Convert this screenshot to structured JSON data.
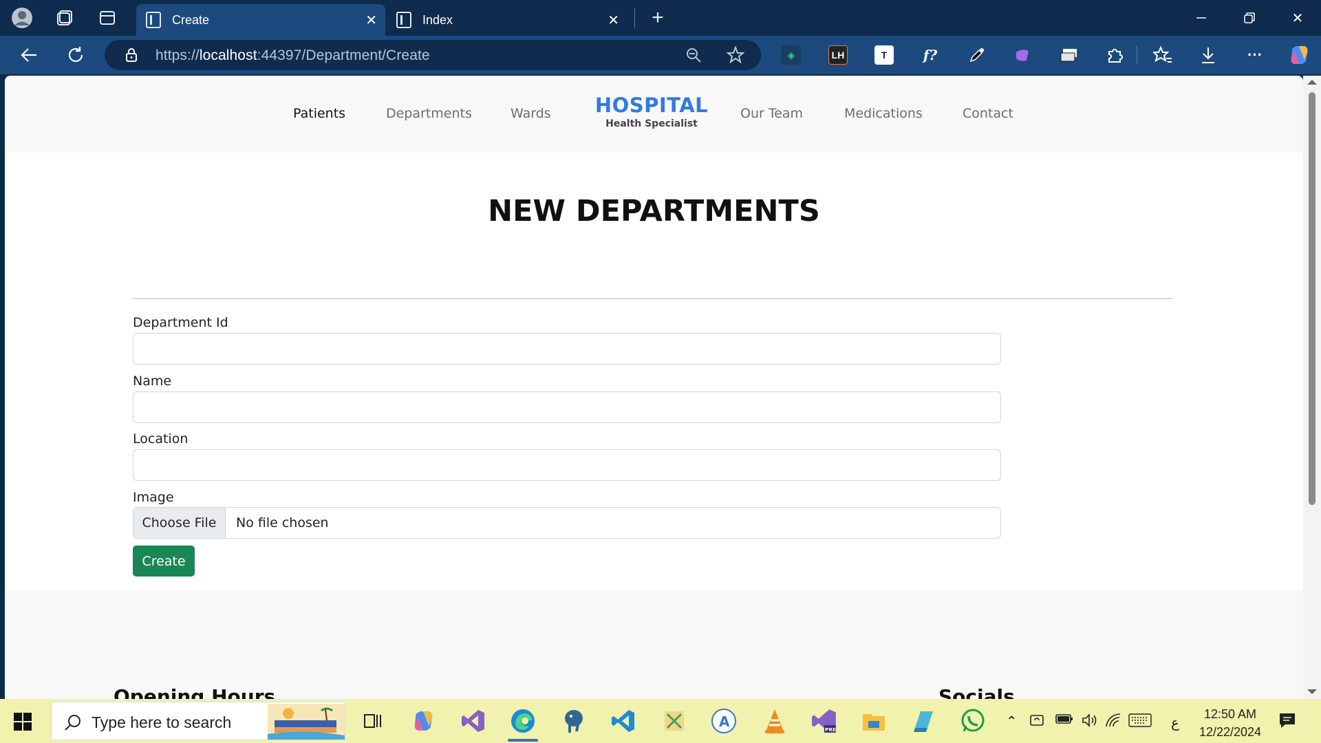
{
  "browser": {
    "tabs": [
      {
        "label": "Create",
        "active": true
      },
      {
        "label": "Index",
        "active": false
      }
    ],
    "url": {
      "scheme": "https://",
      "host": "localhost",
      "rest": ":44397/Department/Create"
    }
  },
  "site": {
    "nav_left": [
      "Patients",
      "Departments",
      "Wards"
    ],
    "brand_title": "HOSPITAL",
    "brand_subtitle": "Health Specialist",
    "nav_right": [
      "Our Team",
      "Medications",
      "Contact"
    ]
  },
  "form": {
    "title": "NEW DEPARTMENTS",
    "department_id_label": "Department Id",
    "name_label": "Name",
    "location_label": "Location",
    "image_label": "Image",
    "choose_file_label": "Choose File",
    "file_status": "No file chosen",
    "create_label": "Create"
  },
  "footer": {
    "opening_hours": "Opening Hours",
    "socials": "Socials"
  },
  "taskbar": {
    "search_placeholder": "Type here to search",
    "time": "12:50 AM",
    "date": "12/22/2024",
    "lang": "ع"
  },
  "colors": {
    "brand": "#2f7be5",
    "create_button": "#198754",
    "taskbar": "#f0f2ad",
    "browser_frame": "#0f2b4d"
  }
}
